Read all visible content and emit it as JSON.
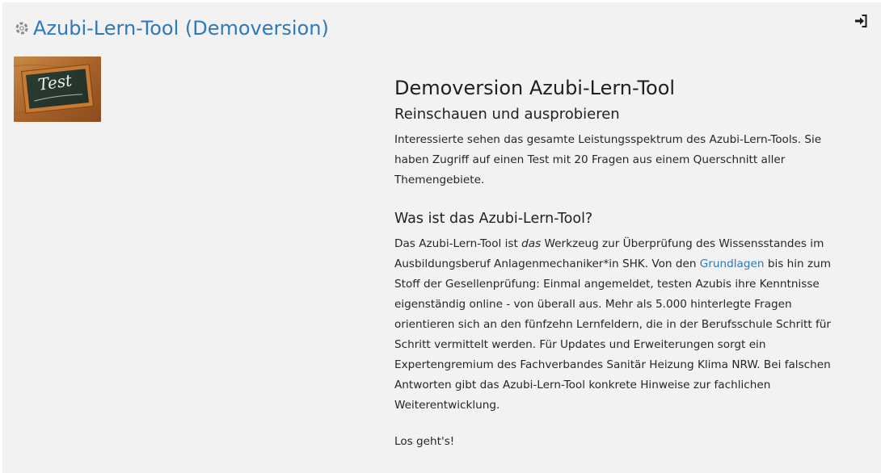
{
  "course": {
    "title": "Azubi-Lern-Tool (Demoversion)",
    "icon": "course-cog-icon",
    "login_icon": "sign-in-icon"
  },
  "thumbnail": {
    "alt": "Test",
    "chalk_text": "Test",
    "colors": {
      "frame": "#b8732e",
      "board": "#2f4a3a"
    }
  },
  "summary": {
    "heading": "Demoversion Azubi-Lern-Tool",
    "subheading": "Reinschauen und ausprobieren",
    "intro": "Interessierte sehen das gesamte Leistungsspektrum des Azubi-Lern-Tools. Sie haben Zugriff auf einen Test mit 20 Fragen aus einem Querschnitt aller Themengebiete.",
    "section_heading": "Was ist das Azubi-Lern-Tool?",
    "body_part1": "Das Azubi-Lern-Tool ist ",
    "body_emph": "das",
    "body_part2": " Werkzeug zur Überprüfung des Wissensstandes im Ausbildungsberuf Anlagenmechaniker*in SHK. Von den ",
    "body_link": "Grundlagen",
    "body_part3": " bis hin zum Stoff der Gesellenprüfung: Einmal angemeldet, testen Azubis ihre Kenntnisse eigenständig online - von überall aus. Mehr als 5.000 hinterlegte Fragen orientieren sich an den fünfzehn Lernfeldern, die in der Berufsschule Schritt für Schritt vermittelt werden. Für Updates und Erweiterungen sorgt ein Expertengremium des Fachverbandes Sanitär Heizung Klima NRW. Bei falschen Antworten gibt das Azubi-Lern-Tool konkrete Hinweise zur fachlichen Weiterentwicklung.",
    "outro": "Los geht's!"
  },
  "colors": {
    "accent": "#2f78b9",
    "panel_bg": "#f2f2f2",
    "text": "#222222"
  }
}
